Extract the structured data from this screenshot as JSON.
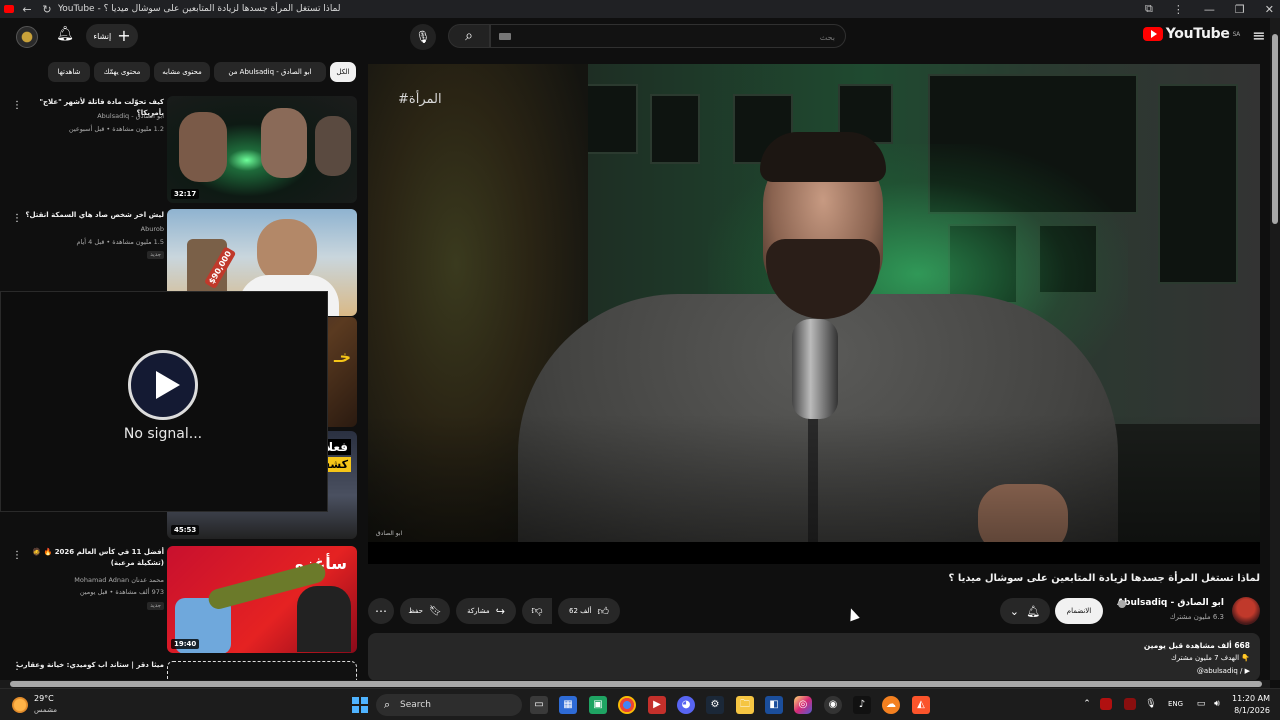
{
  "browser": {
    "tab_title": "YouTube - لماذا تستغل المرأة جسدها لزيادة المتابعين على سوشال ميديا ؟",
    "back_icon": "back-arrow-icon",
    "reload_icon": "reload-icon",
    "extensions_icon": "puzzle-icon",
    "menu_icon": "kebab-icon",
    "window_controls": [
      "—",
      "❐",
      "✕"
    ]
  },
  "header": {
    "logo_text": "YouTube",
    "logo_region": "SA",
    "search_placeholder": "بحث",
    "create_label": "إنشاء",
    "accent_color": "#ff0000"
  },
  "chips": [
    "الكل",
    "من Abulsadiq - ابو الصادق",
    "محتوى مشابه",
    "محتوى يهمّك",
    "شاهدتها"
  ],
  "related": [
    {
      "title": "كيف تحوّلت مادة قاتلة لأشهر \"علاج\" بأمريكا؟",
      "channel": "ابو الصادق - Abulsadiq",
      "meta": "1.2 مليون مشاهدة • قبل أسبوعين",
      "duration": "32:17"
    },
    {
      "title": "ليش اخر شخص صاد هاي السمكة انقتل؟",
      "channel": "Aburob",
      "meta": "1.5 مليون مشاهدة • قبل 4 أيام",
      "badge": "جديد",
      "thumb_text": "$90,000"
    },
    {
      "duration": "45:53",
      "thumb_text_1": "فعلا",
      "thumb_text_2": "كشف"
    },
    {
      "title": "أفضل 11 في كأس العالم 2026 🔥 🧔 (تشكيلة مرعبة)",
      "channel": "محمد عدنان Mohamad Adnan",
      "meta": "973 ألف مشاهدة • قبل يومين",
      "badge": "جديد",
      "duration": "19:40",
      "thumb_text": "سأغزو"
    },
    {
      "title": "ميثا دقر | ستاند اب كوميدي: خيانة وعقارب"
    }
  ],
  "no_signal": {
    "text": "No signal..."
  },
  "video": {
    "hashtag": "#المرأة",
    "watermark": "ابو الصادق",
    "title": "لماذا تستغل المرأة جسدها لزيادة المتابعين على سوشال ميديا ؟",
    "channel_name": "ابو الصادق - Abulsadiq",
    "subscribers": "6.3 مليون مشترك",
    "join_label": "الانضمام",
    "likes": "62 ألف",
    "share_label": "مشاركة",
    "save_label": "حفظ",
    "description": {
      "views_line": "668 ألف مشاهدة  قبل يومين",
      "line2": "👇 الهدف 7 مليون مشترك",
      "line3": "@abulsadiq / ▶"
    }
  },
  "taskbar": {
    "temperature": "29°C",
    "condition": "مشمس",
    "search_label": "Search",
    "language": "ENG",
    "time": "11:20 AM",
    "date": "8/1/2026"
  }
}
